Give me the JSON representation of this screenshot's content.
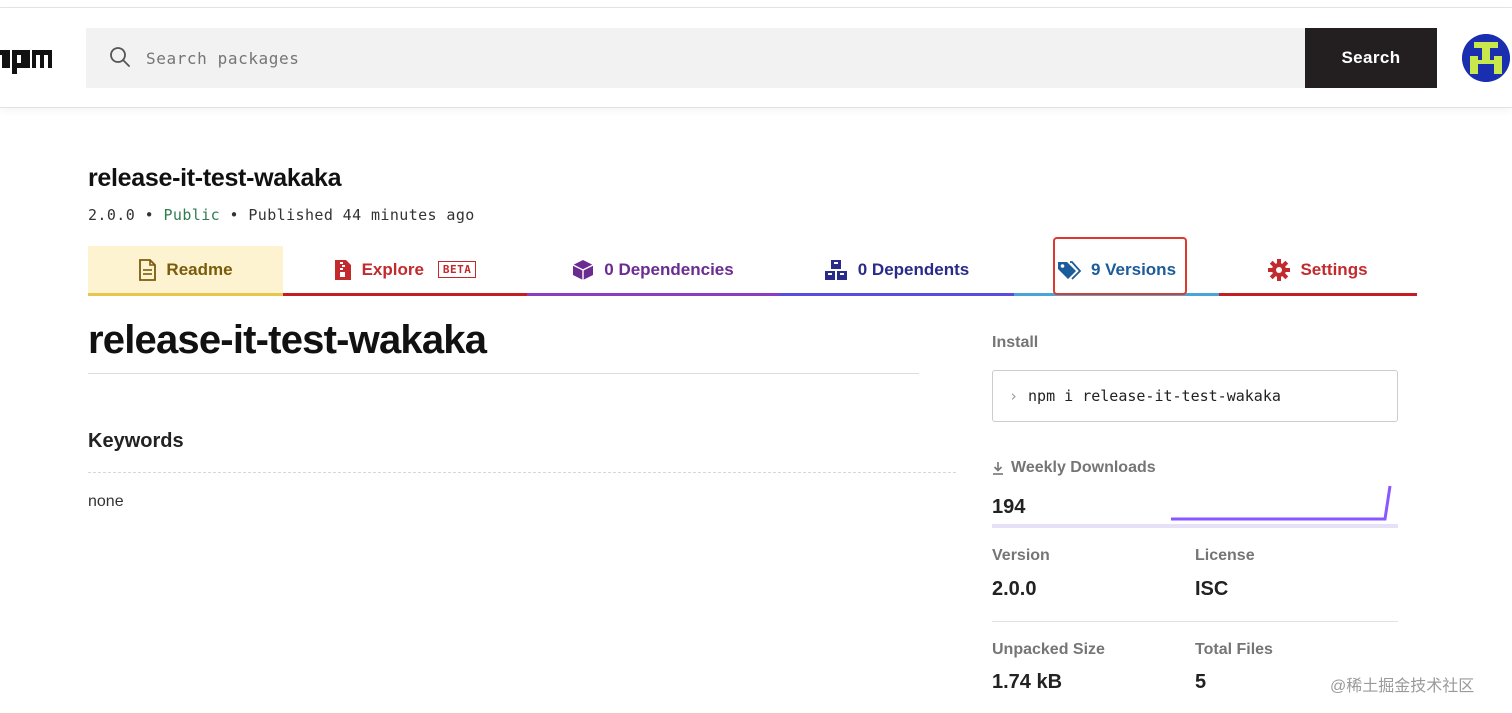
{
  "header": {
    "logo_text": "npm",
    "search": {
      "placeholder": "Search packages",
      "value": ""
    },
    "search_button_label": "Search"
  },
  "package": {
    "name": "release-it-test-wakaka",
    "version": "2.0.0",
    "separator": "•",
    "visibility": "Public",
    "published": "Published 44 minutes ago"
  },
  "tabs": [
    {
      "label": "Readme",
      "icon": "document-icon"
    },
    {
      "label": "Explore",
      "icon": "zip-file-icon",
      "badge": "BETA"
    },
    {
      "label": "0 Dependencies",
      "icon": "box-icon"
    },
    {
      "label": "0 Dependents",
      "icon": "boxes-icon"
    },
    {
      "label": "9 Versions",
      "icon": "tags-icon"
    },
    {
      "label": "Settings",
      "icon": "gear-icon"
    }
  ],
  "readme": {
    "title": "release-it-test-wakaka",
    "keywords_heading": "Keywords",
    "keywords_value": "none"
  },
  "sidebar": {
    "install_label": "Install",
    "install_command": "npm i release-it-test-wakaka",
    "weekly_downloads_label": "Weekly Downloads",
    "weekly_downloads_value": "194",
    "version_label": "Version",
    "version_value": "2.0.0",
    "license_label": "License",
    "license_value": "ISC",
    "unpacked_size_label": "Unpacked Size",
    "unpacked_size_value": "1.74 kB",
    "total_files_label": "Total Files",
    "total_files_value": "5"
  },
  "watermark": "@稀土掘金技术社区",
  "colors": {
    "readme_tab": "#e7c650",
    "explore_tab": "#c41e24",
    "dependencies_tab": "#8a3cc3",
    "dependents_tab": "#5b4ce0",
    "versions_tab": "#4aa4d8",
    "settings_tab": "#c41e24",
    "highlight": "#d93b2e",
    "sparkline": "#8956ff"
  }
}
